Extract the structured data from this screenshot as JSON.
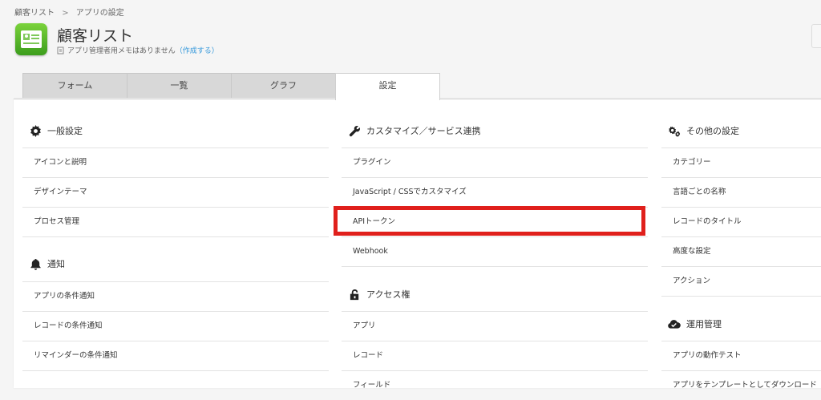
{
  "breadcrumb": {
    "items": [
      "顧客リスト",
      "アプリの設定"
    ],
    "separator": ">"
  },
  "app": {
    "title": "顧客リスト",
    "memo_text": "アプリ管理者用メモはありません",
    "memo_link": "（作成する）"
  },
  "tabs": [
    {
      "label": "フォーム",
      "active": false
    },
    {
      "label": "一覧",
      "active": false
    },
    {
      "label": "グラフ",
      "active": false
    },
    {
      "label": "設定",
      "active": true
    }
  ],
  "columns": {
    "left": {
      "general": {
        "title": "一般設定",
        "icon": "gear-icon",
        "items": [
          "アイコンと説明",
          "デザインテーマ",
          "プロセス管理"
        ]
      },
      "notify": {
        "title": "通知",
        "icon": "bell-icon",
        "items": [
          "アプリの条件通知",
          "レコードの条件通知",
          "リマインダーの条件通知"
        ]
      }
    },
    "middle": {
      "custom": {
        "title": "カスタマイズ／サービス連携",
        "icon": "wrench-icon",
        "items": [
          "プラグイン",
          "JavaScript / CSSでカスタマイズ",
          "APIトークン",
          "Webhook"
        ]
      },
      "access": {
        "title": "アクセス権",
        "icon": "lock-icon",
        "items": [
          "アプリ",
          "レコード",
          "フィールド"
        ]
      }
    },
    "right": {
      "other": {
        "title": "その他の設定",
        "icon": "gears-icon",
        "items": [
          "カテゴリー",
          "言語ごとの名称",
          "レコードのタイトル",
          "高度な設定",
          "アクション"
        ]
      },
      "ops": {
        "title": "運用管理",
        "icon": "cloud-check-icon",
        "items": [
          "アプリの動作テスト",
          "アプリをテンプレートとしてダウンロード"
        ]
      }
    }
  },
  "highlight_color": "#e0201c"
}
